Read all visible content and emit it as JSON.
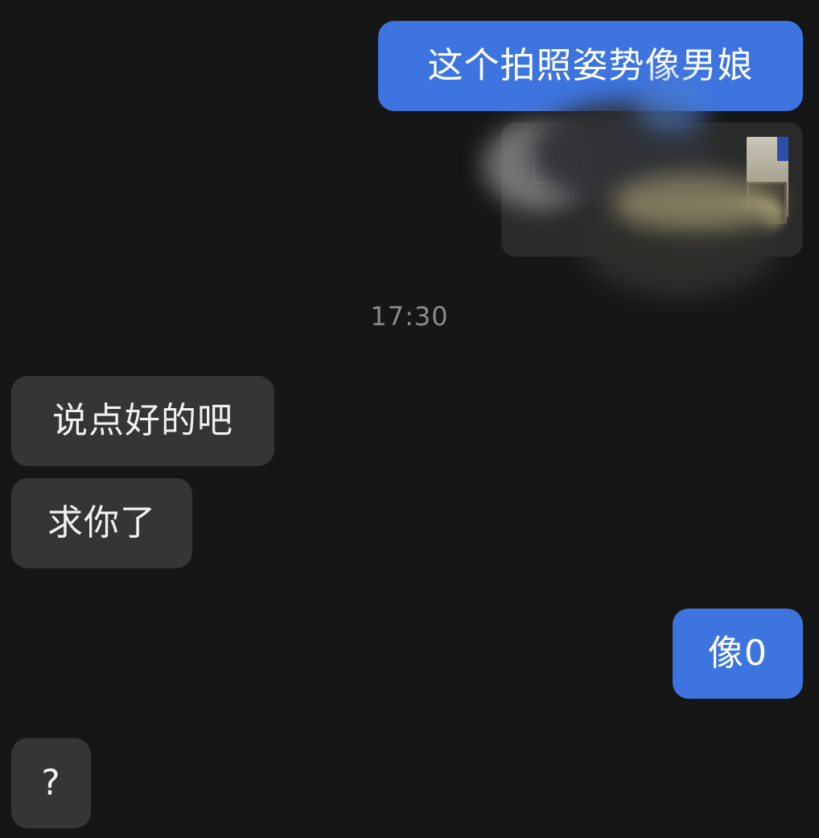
{
  "colors": {
    "background": "#161616",
    "outgoing_bubble": "#3d74e0",
    "incoming_bubble": "#353535",
    "timestamp_text": "#8a8a8a"
  },
  "messages": [
    {
      "direction": "outgoing",
      "type": "text",
      "text": "这个拍照姿势像男娘"
    },
    {
      "direction": "outgoing",
      "type": "image",
      "note": "blurred photo"
    },
    {
      "direction": "incoming",
      "type": "text",
      "text": "说点好的吧"
    },
    {
      "direction": "incoming",
      "type": "text",
      "text": "求你了"
    },
    {
      "direction": "outgoing",
      "type": "text",
      "text": "像0"
    },
    {
      "direction": "incoming",
      "type": "text",
      "text": "?"
    }
  ],
  "timestamp": "17:30"
}
